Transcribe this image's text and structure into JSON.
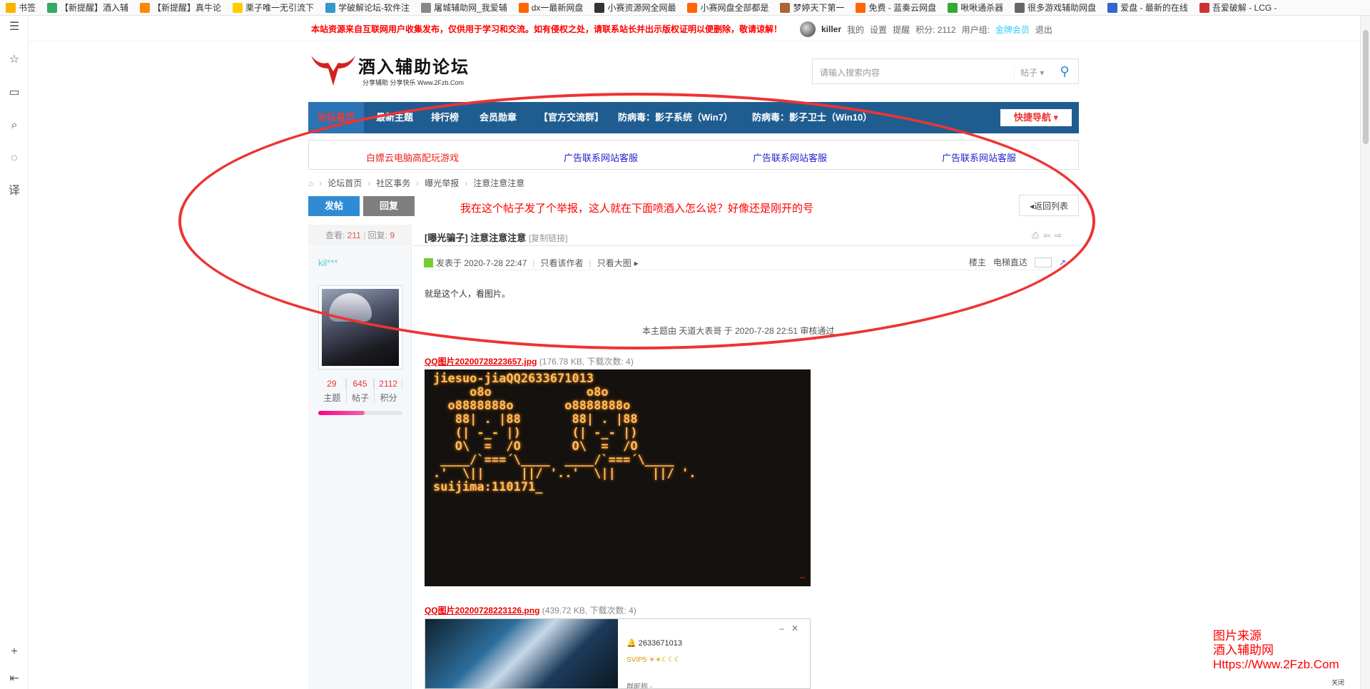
{
  "bookmarks": [
    {
      "label": "书签",
      "color": "#f5b400"
    },
    {
      "label": "【新提醒】酒入辅",
      "color": "#3a6"
    },
    {
      "label": "【新提醒】真牛论",
      "color": "#f80"
    },
    {
      "label": "栗子唯一无引流下",
      "color": "#fc0"
    },
    {
      "label": "学破解论坛-软件注",
      "color": "#39c"
    },
    {
      "label": "屠城辅助网_我爱辅",
      "color": "#888"
    },
    {
      "label": "dx一最新网盘",
      "color": "#f60"
    },
    {
      "label": "小赛资源网全网最",
      "color": "#333"
    },
    {
      "label": "小赛网盘全部都是",
      "color": "#f60"
    },
    {
      "label": "梦婷天下第一",
      "color": "#a63"
    },
    {
      "label": "免费 - 蓝奏云网盘",
      "color": "#f60"
    },
    {
      "label": "啾啾通杀器",
      "color": "#3a3"
    },
    {
      "label": "很多游戏辅助网盘",
      "color": "#666"
    },
    {
      "label": "爱盘 - 最新的在线",
      "color": "#36c"
    },
    {
      "label": "吾爱破解 - LCG -",
      "color": "#c33"
    }
  ],
  "sidebar_icons": [
    "menu-icon",
    "star-icon",
    "book-icon",
    "search-icon",
    "chat-icon",
    "translate-icon",
    "plus-icon",
    "collapse-icon"
  ],
  "topbar": {
    "notice": "本站资源来自互联网用户收集发布，仅供用于学习和交流。如有侵权之处，请联系站长并出示版权证明以便删除，敬请谅解！",
    "username": "killer",
    "links": [
      "我的",
      "设置",
      "提醒",
      "积分: 2112",
      "用户组:",
      "金牌会员",
      "退出"
    ]
  },
  "logo": {
    "title": "酒入辅助论坛",
    "subtitle": "分享辅助 分享快乐 Www.2Fzb.Com"
  },
  "search": {
    "placeholder": "请输入搜索内容",
    "type": "帖子"
  },
  "nav": {
    "items": [
      "论坛首页",
      "最新主题",
      "排行榜",
      "会员勋章",
      "【官方交流群】",
      "防病毒：影子系统（Win7）",
      "防病毒：影子卫士（Win10）"
    ],
    "quick": "快捷导航"
  },
  "ads": [
    "白嫖云电脑高配玩游戏",
    "广告联系网站客服",
    "广告联系网站客服",
    "广告联系网站客服"
  ],
  "breadcrumb": [
    "论坛首页",
    "社区事务",
    "曝光举报",
    "注意注意注意"
  ],
  "buttons": {
    "post": "发帖",
    "reply": "回复",
    "back": "返回列表"
  },
  "annotation": "我在这个帖子发了个举报，这人就在下面喷酒入怎么说？好像还是刚开的号",
  "thread": {
    "views_label": "查看:",
    "views": "211",
    "replies_label": "回复:",
    "replies": "9",
    "tag": "[曝光骗子]",
    "title": "注意注意注意",
    "copy": "[复制链接]"
  },
  "author": {
    "name": "kil***",
    "stats": [
      {
        "n": "29",
        "l": "主题"
      },
      {
        "n": "645",
        "l": "帖子"
      },
      {
        "n": "2112",
        "l": "积分"
      }
    ],
    "level_progress": 0.55
  },
  "post": {
    "time": "发表于 2020-7-28 22:47",
    "only_author": "只看该作者",
    "big_img": "只看大图",
    "floor": "楼主",
    "jump": "电梯直达",
    "content": "就是这个人，看图片。",
    "audit": "本主题由 天道大表哥 于 2020-7-28 22:51 审核通过"
  },
  "attachments": [
    {
      "name": "QQ图片20200728223657.jpg",
      "info": "(176.78 KB, 下载次数: 4)"
    },
    {
      "name": "QQ图片20200728223126.png",
      "info": "(439.72 KB, 下载次数: 4)"
    }
  ],
  "screen_text": "jiesuo-jiaQQ2633671013\n     o8o             o8o\n  o8888888o       o8888888o\n   88| . |88       88| . |88\n   (| -_- |)       (| -_- |)\n   O\\  =  /O       O\\  =  /O\n ____/`===´\\____  ____/`===´\\____\n.'  \\||     ||/ '..'  \\||     ||/ '.\nsuijima:110171_",
  "qq_panel": {
    "qq": "2633671013",
    "level": "SVIP5",
    "nick": "群昵称"
  },
  "source": {
    "line1": "图片来源",
    "line2": "酒入辅助网",
    "line3": "Https://Www.2Fzb.Com",
    "close": "关闭"
  }
}
